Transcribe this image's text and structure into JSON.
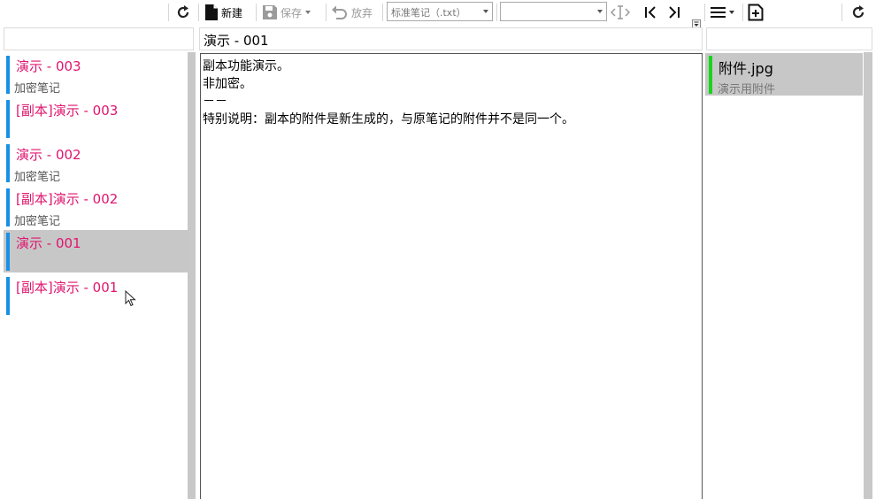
{
  "toolbar": {
    "new_label": "新建",
    "save_label": "保存",
    "discard_label": "放弃",
    "format_select": "标准笔记（.txt）",
    "second_select": ""
  },
  "notes": [
    {
      "title": "演示 - 003",
      "subtitle": "加密笔记"
    },
    {
      "title": "[副本]演示 - 003",
      "subtitle": ""
    },
    {
      "title": "演示 - 002",
      "subtitle": "加密笔记"
    },
    {
      "title": "[副本]演示 - 002",
      "subtitle": "加密笔记"
    },
    {
      "title": "演示 - 001",
      "subtitle": ""
    },
    {
      "title": "[副本]演示 - 001",
      "subtitle": ""
    }
  ],
  "editor": {
    "title": "演示 - 001",
    "lines": [
      "副本功能演示。",
      "非加密。",
      "－－",
      "特别说明：副本的附件是新生成的，与原笔记的附件并不是同一个。"
    ]
  },
  "attachments": [
    {
      "name": "附件.jpg",
      "description": "演示用附件"
    }
  ],
  "colors": {
    "note_title": "#e0156f",
    "note_bar": "#1a8fe6",
    "attachment_bar": "#16d51a",
    "selection": "#c7c7c7"
  }
}
